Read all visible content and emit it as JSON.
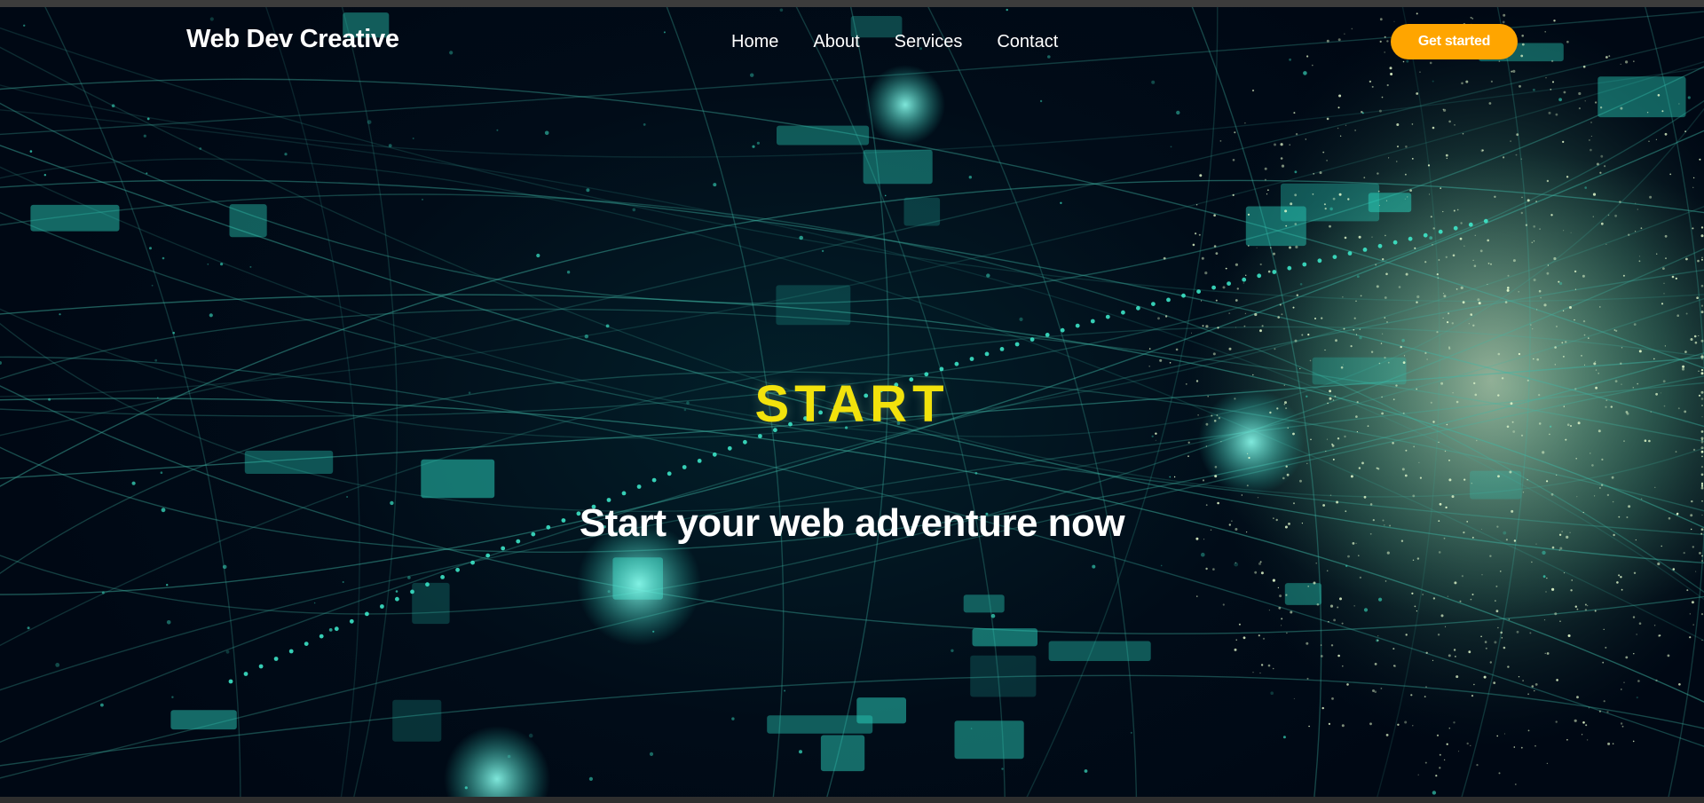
{
  "brand": {
    "name": "Web Dev Creative"
  },
  "nav": {
    "items": [
      {
        "label": "Home"
      },
      {
        "label": "About"
      },
      {
        "label": "Services"
      },
      {
        "label": "Contact"
      }
    ],
    "cta_label": "Get started"
  },
  "hero": {
    "title": "START",
    "subtitle": "Start your web adventure now",
    "background": "abstract-network-data-visualization"
  },
  "colors": {
    "cta": "#ffa500",
    "title": "#f2e20c",
    "text": "#ffffff",
    "background": "#010c18",
    "accent": "#2fe0c0"
  }
}
